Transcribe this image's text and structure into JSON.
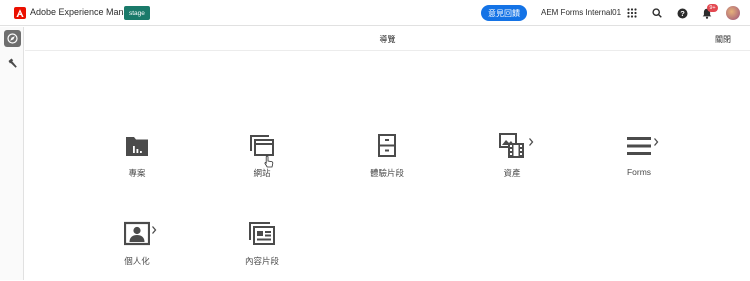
{
  "topbar": {
    "brand_name": "Adobe Experience Manager",
    "environment_badge": "stage",
    "feedback_button": "意見回饋",
    "organization": "AEM Forms Internal01",
    "notification_count": "9+",
    "icons": [
      "adobe-logo",
      "apps-grid-icon",
      "search-icon",
      "help-icon",
      "bell-icon",
      "user-avatar"
    ]
  },
  "rail": {
    "items": [
      {
        "icon": "navigation-compass-icon",
        "active": true
      },
      {
        "icon": "tools-hammer-icon",
        "active": false
      }
    ]
  },
  "navigation": {
    "title": "導覽",
    "close_label": "關閉",
    "tiles": [
      {
        "label": "專案",
        "icon": "projects-icon",
        "has_submenu": false
      },
      {
        "label": "網站",
        "icon": "sites-icon",
        "has_submenu": false
      },
      {
        "label": "體驗片段",
        "icon": "experience-fragments-icon",
        "has_submenu": false
      },
      {
        "label": "資產",
        "icon": "assets-icon",
        "has_submenu": true
      },
      {
        "label": "Forms",
        "icon": "forms-icon",
        "has_submenu": true
      },
      {
        "label": "個人化",
        "icon": "personalization-icon",
        "has_submenu": true
      },
      {
        "label": "內容片段",
        "icon": "content-fragments-icon",
        "has_submenu": false
      }
    ]
  },
  "colors": {
    "accent_blue": "#1473e6",
    "badge_teal": "#1a7a6a",
    "adobe_red": "#eb1000",
    "icon_gray": "#4b4b4b"
  }
}
